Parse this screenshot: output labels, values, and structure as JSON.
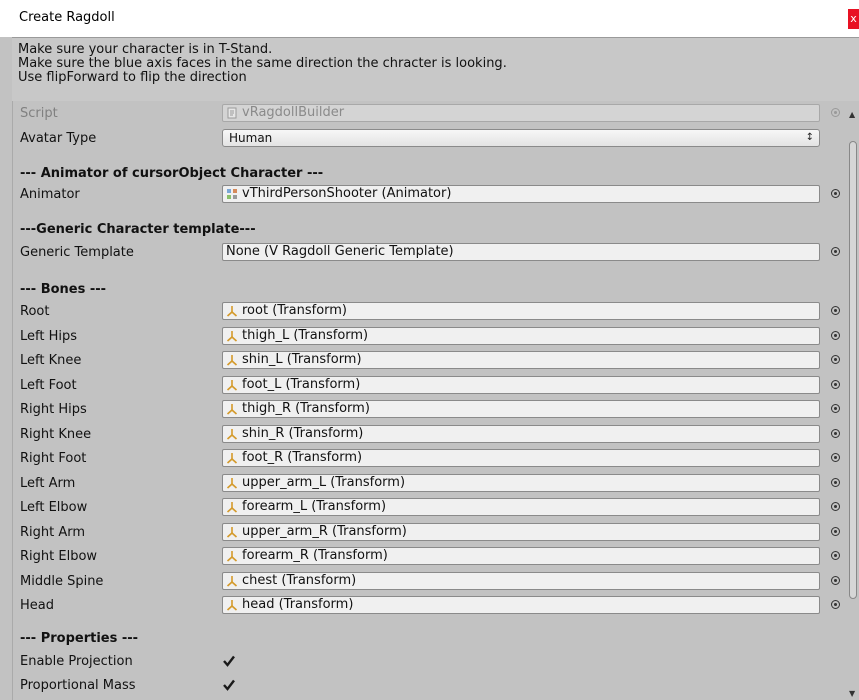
{
  "window": {
    "title": "Create Ragdoll",
    "close_label": "x"
  },
  "help": {
    "lines": [
      "Make sure your character is in T-Stand.",
      "Make sure the blue axis faces in the same direction the chracter is looking.",
      "Use flipForward to flip the direction"
    ]
  },
  "script": {
    "label": "Script",
    "value": "vRagdollBuilder"
  },
  "avatar_type": {
    "label": "Avatar Type",
    "value": "Human",
    "arrow": "↕"
  },
  "animator_section": {
    "header": "--- Animator of cursorObject Character ---",
    "label": "Animator",
    "value": "vThirdPersonShooter (Animator)"
  },
  "generic_section": {
    "header": "---Generic Character template---",
    "label": "Generic Template",
    "value": "None (V Ragdoll Generic Template)"
  },
  "bones": {
    "header": "--- Bones ---",
    "items": [
      {
        "label": "Root",
        "value": "root (Transform)"
      },
      {
        "label": "Left Hips",
        "value": "thigh_L (Transform)"
      },
      {
        "label": "Left Knee",
        "value": "shin_L (Transform)"
      },
      {
        "label": "Left Foot",
        "value": "foot_L (Transform)"
      },
      {
        "label": "Right Hips",
        "value": "thigh_R (Transform)"
      },
      {
        "label": "Right Knee",
        "value": "shin_R (Transform)"
      },
      {
        "label": "Right Foot",
        "value": "foot_R (Transform)"
      },
      {
        "label": "Left Arm",
        "value": "upper_arm_L (Transform)"
      },
      {
        "label": "Left Elbow",
        "value": "forearm_L (Transform)"
      },
      {
        "label": "Right Arm",
        "value": "upper_arm_R (Transform)"
      },
      {
        "label": "Right Elbow",
        "value": "forearm_R (Transform)"
      },
      {
        "label": "Middle Spine",
        "value": "chest (Transform)"
      },
      {
        "label": "Head",
        "value": "head (Transform)"
      }
    ]
  },
  "properties": {
    "header": "--- Properties ---",
    "items": [
      {
        "label": "Enable Projection",
        "checked": true
      },
      {
        "label": "Proportional Mass",
        "checked": true
      }
    ]
  },
  "colors": {
    "panel_bg": "#c2c2c2",
    "field_bg": "#f0f0f0",
    "close_button": "#e81123",
    "transform_icon": "#d49a2a"
  }
}
